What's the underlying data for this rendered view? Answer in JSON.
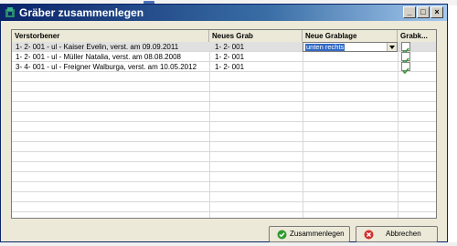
{
  "window": {
    "title": "Gräber zusammenlegen"
  },
  "table": {
    "headers": [
      "Verstorbener",
      "Neues Grab",
      "Neue Grablage",
      "Grabk..."
    ],
    "rows": [
      {
        "verstorbener": "1- 2- 001 - ul - Kaiser Evelin, verst. am 09.09.2011",
        "neues_grab": "1- 2- 001",
        "grablage": "unten rechts",
        "checked": true
      },
      {
        "verstorbener": "1- 2- 001 - ul - Müller Natalia, verst. am 08.08.2008",
        "neues_grab": "1- 2- 001",
        "grablage": "",
        "checked": true
      },
      {
        "verstorbener": "3- 4- 001 - ul - Freigner Walburga, verst. am 10.05.2012",
        "neues_grab": "1- 2- 001",
        "grablage": "",
        "checked": true
      }
    ]
  },
  "buttons": {
    "merge_label": "Zusammenlegen",
    "cancel_label": "Abbrechen"
  },
  "colors": {
    "title_start": "#0a246a",
    "title_end": "#a6caf0",
    "check": "#2e9b2e",
    "merge_icon": "#2e9b2e",
    "cancel_icon": "#d32f2f"
  }
}
